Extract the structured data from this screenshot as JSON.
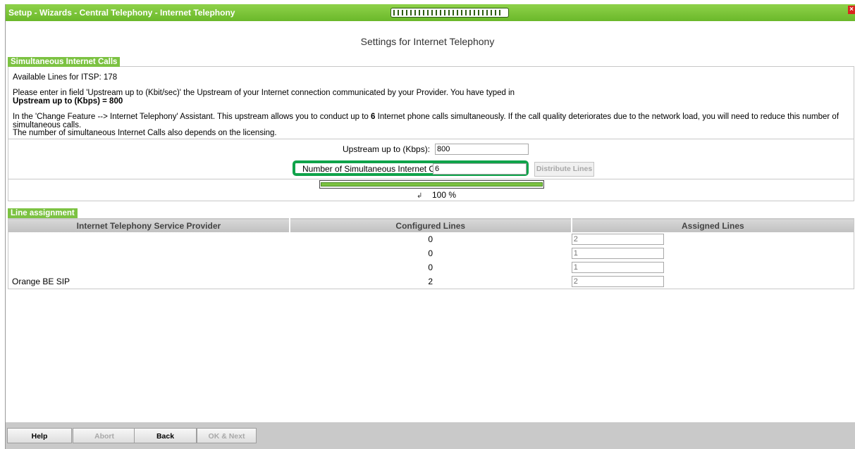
{
  "window": {
    "title": "Setup - Wizards - Central Telephony - Internet Telephony",
    "close_glyph": "×"
  },
  "page": {
    "heading": "Settings for Internet Telephony"
  },
  "simultaneous": {
    "legend": "Simultaneous Internet Calls",
    "available_lines": "Available Lines for ITSP: 178",
    "instruction": "Please enter in field 'Upstream up to (Kbit/sec)' the Upstream of your Internet connection communicated by your Provider. You have typed in",
    "upstream_typed": "Upstream up to (Kbps) = 800",
    "assistant_pre": "In the 'Change Feature --> Internet Telephony' Assistant. This upstream allows you to conduct up to ",
    "assistant_count": "6",
    "assistant_post": " Internet phone calls simultaneously. If the call quality deteriorates due to the network load, you will need to reduce this number of simultaneous calls.",
    "licensing_note": "The number of simultaneous Internet Calls also depends on the licensing.",
    "upstream_label": "Upstream up to (Kbps):",
    "upstream_value": "800",
    "calls_label": "Number of Simultaneous Internet Calls:",
    "calls_value": "6",
    "distribute_button": "Distribute Lines",
    "progress_fraction": 1.0,
    "progress_text": "100 %"
  },
  "line_assignment": {
    "legend": "Line assignment",
    "columns": [
      "Internet Telephony Service Provider",
      "Configured Lines",
      "Assigned Lines"
    ],
    "rows": [
      {
        "provider": "",
        "configured": "0",
        "assigned": "2"
      },
      {
        "provider": "",
        "configured": "0",
        "assigned": "1"
      },
      {
        "provider": "",
        "configured": "0",
        "assigned": "1"
      },
      {
        "provider": "Orange BE SIP",
        "configured": "2",
        "assigned": "2"
      }
    ]
  },
  "footer": {
    "help": "Help",
    "abort": "Abort",
    "back": "Back",
    "ok_next": "OK & Next"
  }
}
